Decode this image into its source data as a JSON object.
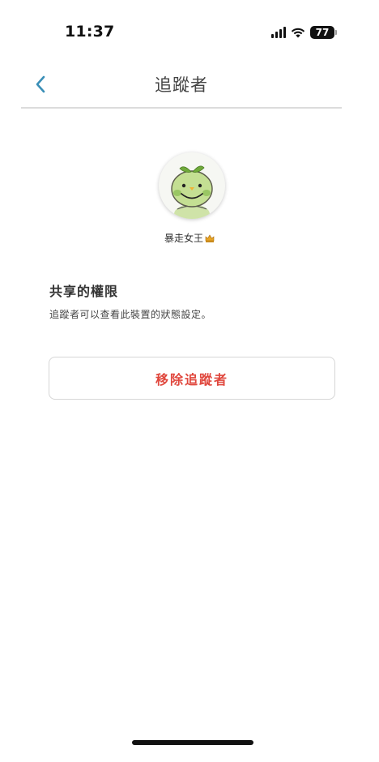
{
  "status_bar": {
    "time": "11:37",
    "battery": "77",
    "icons": [
      "signal-icon",
      "wifi-icon",
      "battery-icon"
    ]
  },
  "nav": {
    "back_icon": "chevron-left-icon",
    "title": "追蹤者"
  },
  "profile": {
    "avatar_icon": "green-mascot-avatar",
    "name": "暴走女王",
    "badge_icon": "crown-icon"
  },
  "permissions": {
    "title": "共享的權限",
    "description": "追蹤者可以查看此裝置的狀態設定。"
  },
  "actions": {
    "remove_label": "移除追蹤者"
  },
  "colors": {
    "accent": "#3a8fb7",
    "danger": "#e0473d",
    "divider": "#dcdcdc",
    "button_border": "#d6d6d6"
  }
}
